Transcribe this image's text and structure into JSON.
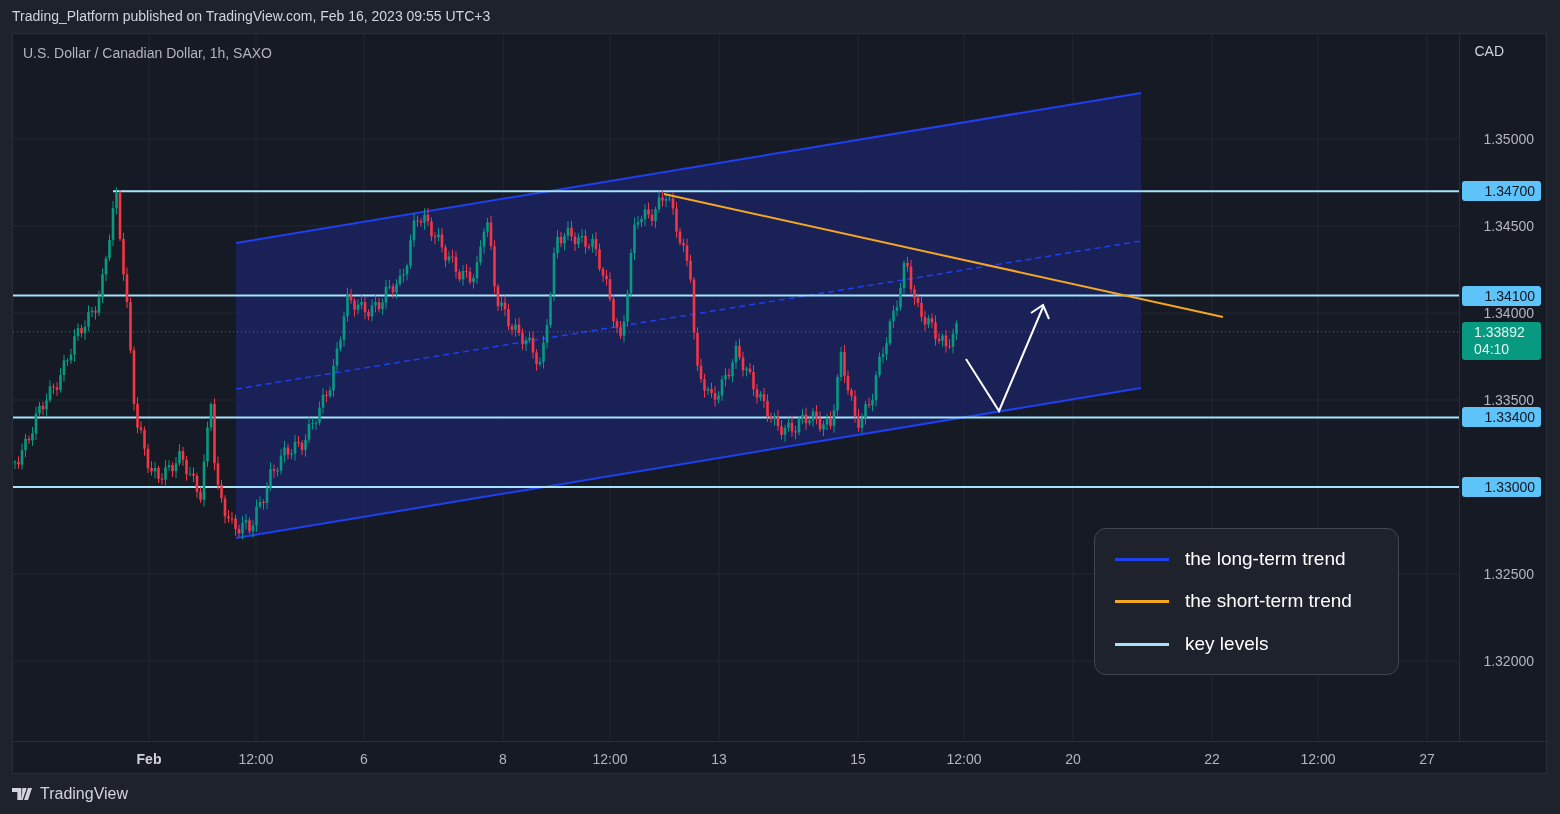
{
  "header": {
    "title": "Trading_Platform published on TradingView.com, Feb 16, 2023 09:55 UTC+3"
  },
  "chart": {
    "symbol": "U.S. Dollar / Canadian Dollar, 1h, SAXO",
    "currency": "CAD",
    "price_ticks": [
      "1.35000",
      "1.34500",
      "1.34000",
      "1.33500",
      "1.32500",
      "1.32000"
    ],
    "key_levels": [
      "1.34700",
      "1.34100",
      "1.33400",
      "1.33000"
    ],
    "current_price": {
      "price": "1.33892",
      "countdown": "04:10"
    },
    "time_labels": [
      {
        "label": "Feb",
        "kind": "month"
      },
      {
        "label": "12:00",
        "kind": "time"
      },
      {
        "label": "6",
        "kind": "day"
      },
      {
        "label": "8",
        "kind": "day"
      },
      {
        "label": "12:00",
        "kind": "time"
      },
      {
        "label": "13",
        "kind": "day"
      },
      {
        "label": "15",
        "kind": "day"
      },
      {
        "label": "12:00",
        "kind": "time"
      },
      {
        "label": "20",
        "kind": "day"
      },
      {
        "label": "22",
        "kind": "day"
      },
      {
        "label": "12:00",
        "kind": "time"
      },
      {
        "label": "27",
        "kind": "day"
      }
    ],
    "legend": [
      {
        "label": "the long-term trend",
        "color": "#1f3ff0"
      },
      {
        "label": "the short-term trend",
        "color": "#f5a623"
      },
      {
        "label": "key levels",
        "color": "#a6e3fb"
      }
    ]
  },
  "footer": {
    "brand": "TradingView"
  }
}
